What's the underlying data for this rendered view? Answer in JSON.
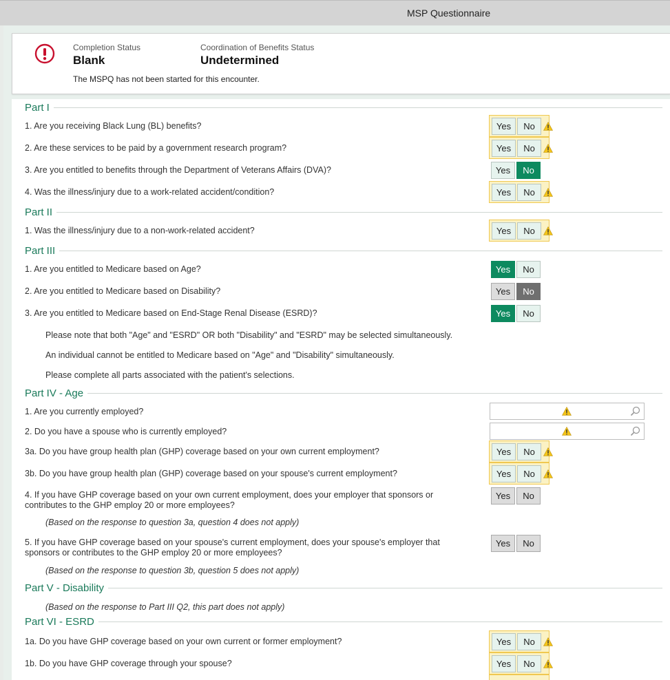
{
  "window": {
    "title": "MSP Questionnaire"
  },
  "status": {
    "completion_label": "Completion Status",
    "completion_value": "Blank",
    "cob_label": "Coordination of Benefits Status",
    "cob_value": "Undetermined",
    "message": "The MSPQ has not been started for this encounter."
  },
  "buttons": {
    "yes": "Yes",
    "no": "No"
  },
  "parts": {
    "p1": "Part I",
    "p2": "Part II",
    "p3": "Part III",
    "p4": "Part IV - Age",
    "p5": "Part V - Disability",
    "p6": "Part VI - ESRD"
  },
  "questions": {
    "p1q1": "1. Are you receiving Black Lung (BL) benefits?",
    "p1q2": "2. Are these services to be paid by a government research program?",
    "p1q3": "3. Are you entitled to benefits through the Department of Veterans Affairs (DVA)?",
    "p1q4": "4. Was the illness/injury due to a work-related accident/condition?",
    "p2q1": "1. Was the illness/injury due to a non-work-related accident?",
    "p3q1": "1. Are you entitled to Medicare based on Age?",
    "p3q2": "2. Are you entitled to Medicare based on Disability?",
    "p3q3": "3. Are you entitled to Medicare based on End-Stage Renal Disease (ESRD)?",
    "p4q1": "1. Are you currently employed?",
    "p4q2": "2. Do you have a spouse who is currently employed?",
    "p4q3a": "3a. Do you have group health plan (GHP) coverage based on your own current employment?",
    "p4q3b": "3b. Do you have group health plan (GHP) coverage based on your spouse's current employment?",
    "p4q4_l1": "4. If you have GHP coverage based on your own current employment, does your employer that sponsors or",
    "p4q4_l2": "contributes to the GHP employ 20 or more employees?",
    "p4q5_l1": "5. If you have GHP coverage based on your spouse's current employment, does your spouse's employer that",
    "p4q5_l2": "sponsors or contributes to the GHP employ 20 or more employees?",
    "p6q1a": "1a. Do you have GHP coverage based on your own current or former employment?",
    "p6q1b": "1b. Do you have GHP coverage through your spouse?"
  },
  "notes": {
    "p3n1": "Please note that both \"Age\" and \"ESRD\" OR both \"Disability\" and \"ESRD\" may be selected simultaneously.",
    "p3n2": "An individual cannot be entitled to Medicare based on \"Age\" and \"Disability\" simultaneously.",
    "p3n3": "Please complete all parts associated with the patient's selections.",
    "p4n4": "(Based on the response to question 3a, question 4 does not apply)",
    "p4n5": "(Based on the response to question 3b, question 5 does not apply)",
    "p5n": "(Based on the response to Part III Q2, this part does not apply)"
  },
  "colors": {
    "accent": "#0d8a5f",
    "part_heading": "#1a7a5a",
    "warning": "#f5c518"
  },
  "icons": [
    "alert-circle-icon",
    "warning-icon",
    "search-icon"
  ]
}
